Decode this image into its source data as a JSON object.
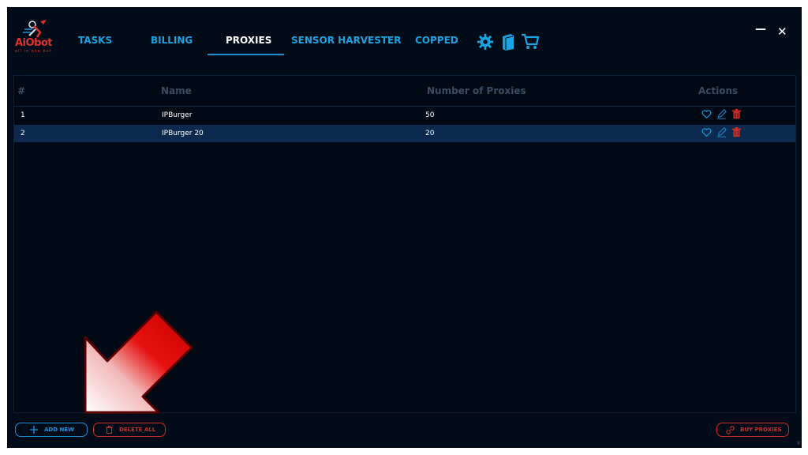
{
  "app": {
    "logo_text": "AiObot",
    "logo_sub": "all in one bot"
  },
  "nav": {
    "items": [
      {
        "label": "TASKS"
      },
      {
        "label": "BILLING"
      },
      {
        "label": "PROXIES"
      },
      {
        "label": "SENSOR HARVESTER"
      },
      {
        "label": "COPPED"
      }
    ],
    "active": "PROXIES",
    "icons": [
      "gear-icon",
      "book-icon",
      "cart-icon"
    ],
    "accent": "#1aa3e0"
  },
  "window": {
    "minimize": "—",
    "close": "✕"
  },
  "table": {
    "headers": {
      "index": "#",
      "name": "Name",
      "count": "Number of Proxies",
      "actions": "Actions"
    },
    "rows": [
      {
        "index": "1",
        "name": "IPBurger",
        "count": "50",
        "selected": false
      },
      {
        "index": "2",
        "name": "IPBurger 20",
        "count": "20",
        "selected": true
      }
    ],
    "row_action_icons": [
      "heart-icon",
      "edit-icon",
      "trash-icon"
    ]
  },
  "footer": {
    "add_new": "ADD NEW",
    "delete_all": "DELETE ALL",
    "buy_proxies": "BUY PROXIES"
  },
  "colors": {
    "background": "#020b18",
    "danger": "#c8302d",
    "primary": "#1a8fd6",
    "row_selected": "#0b2a4d"
  }
}
